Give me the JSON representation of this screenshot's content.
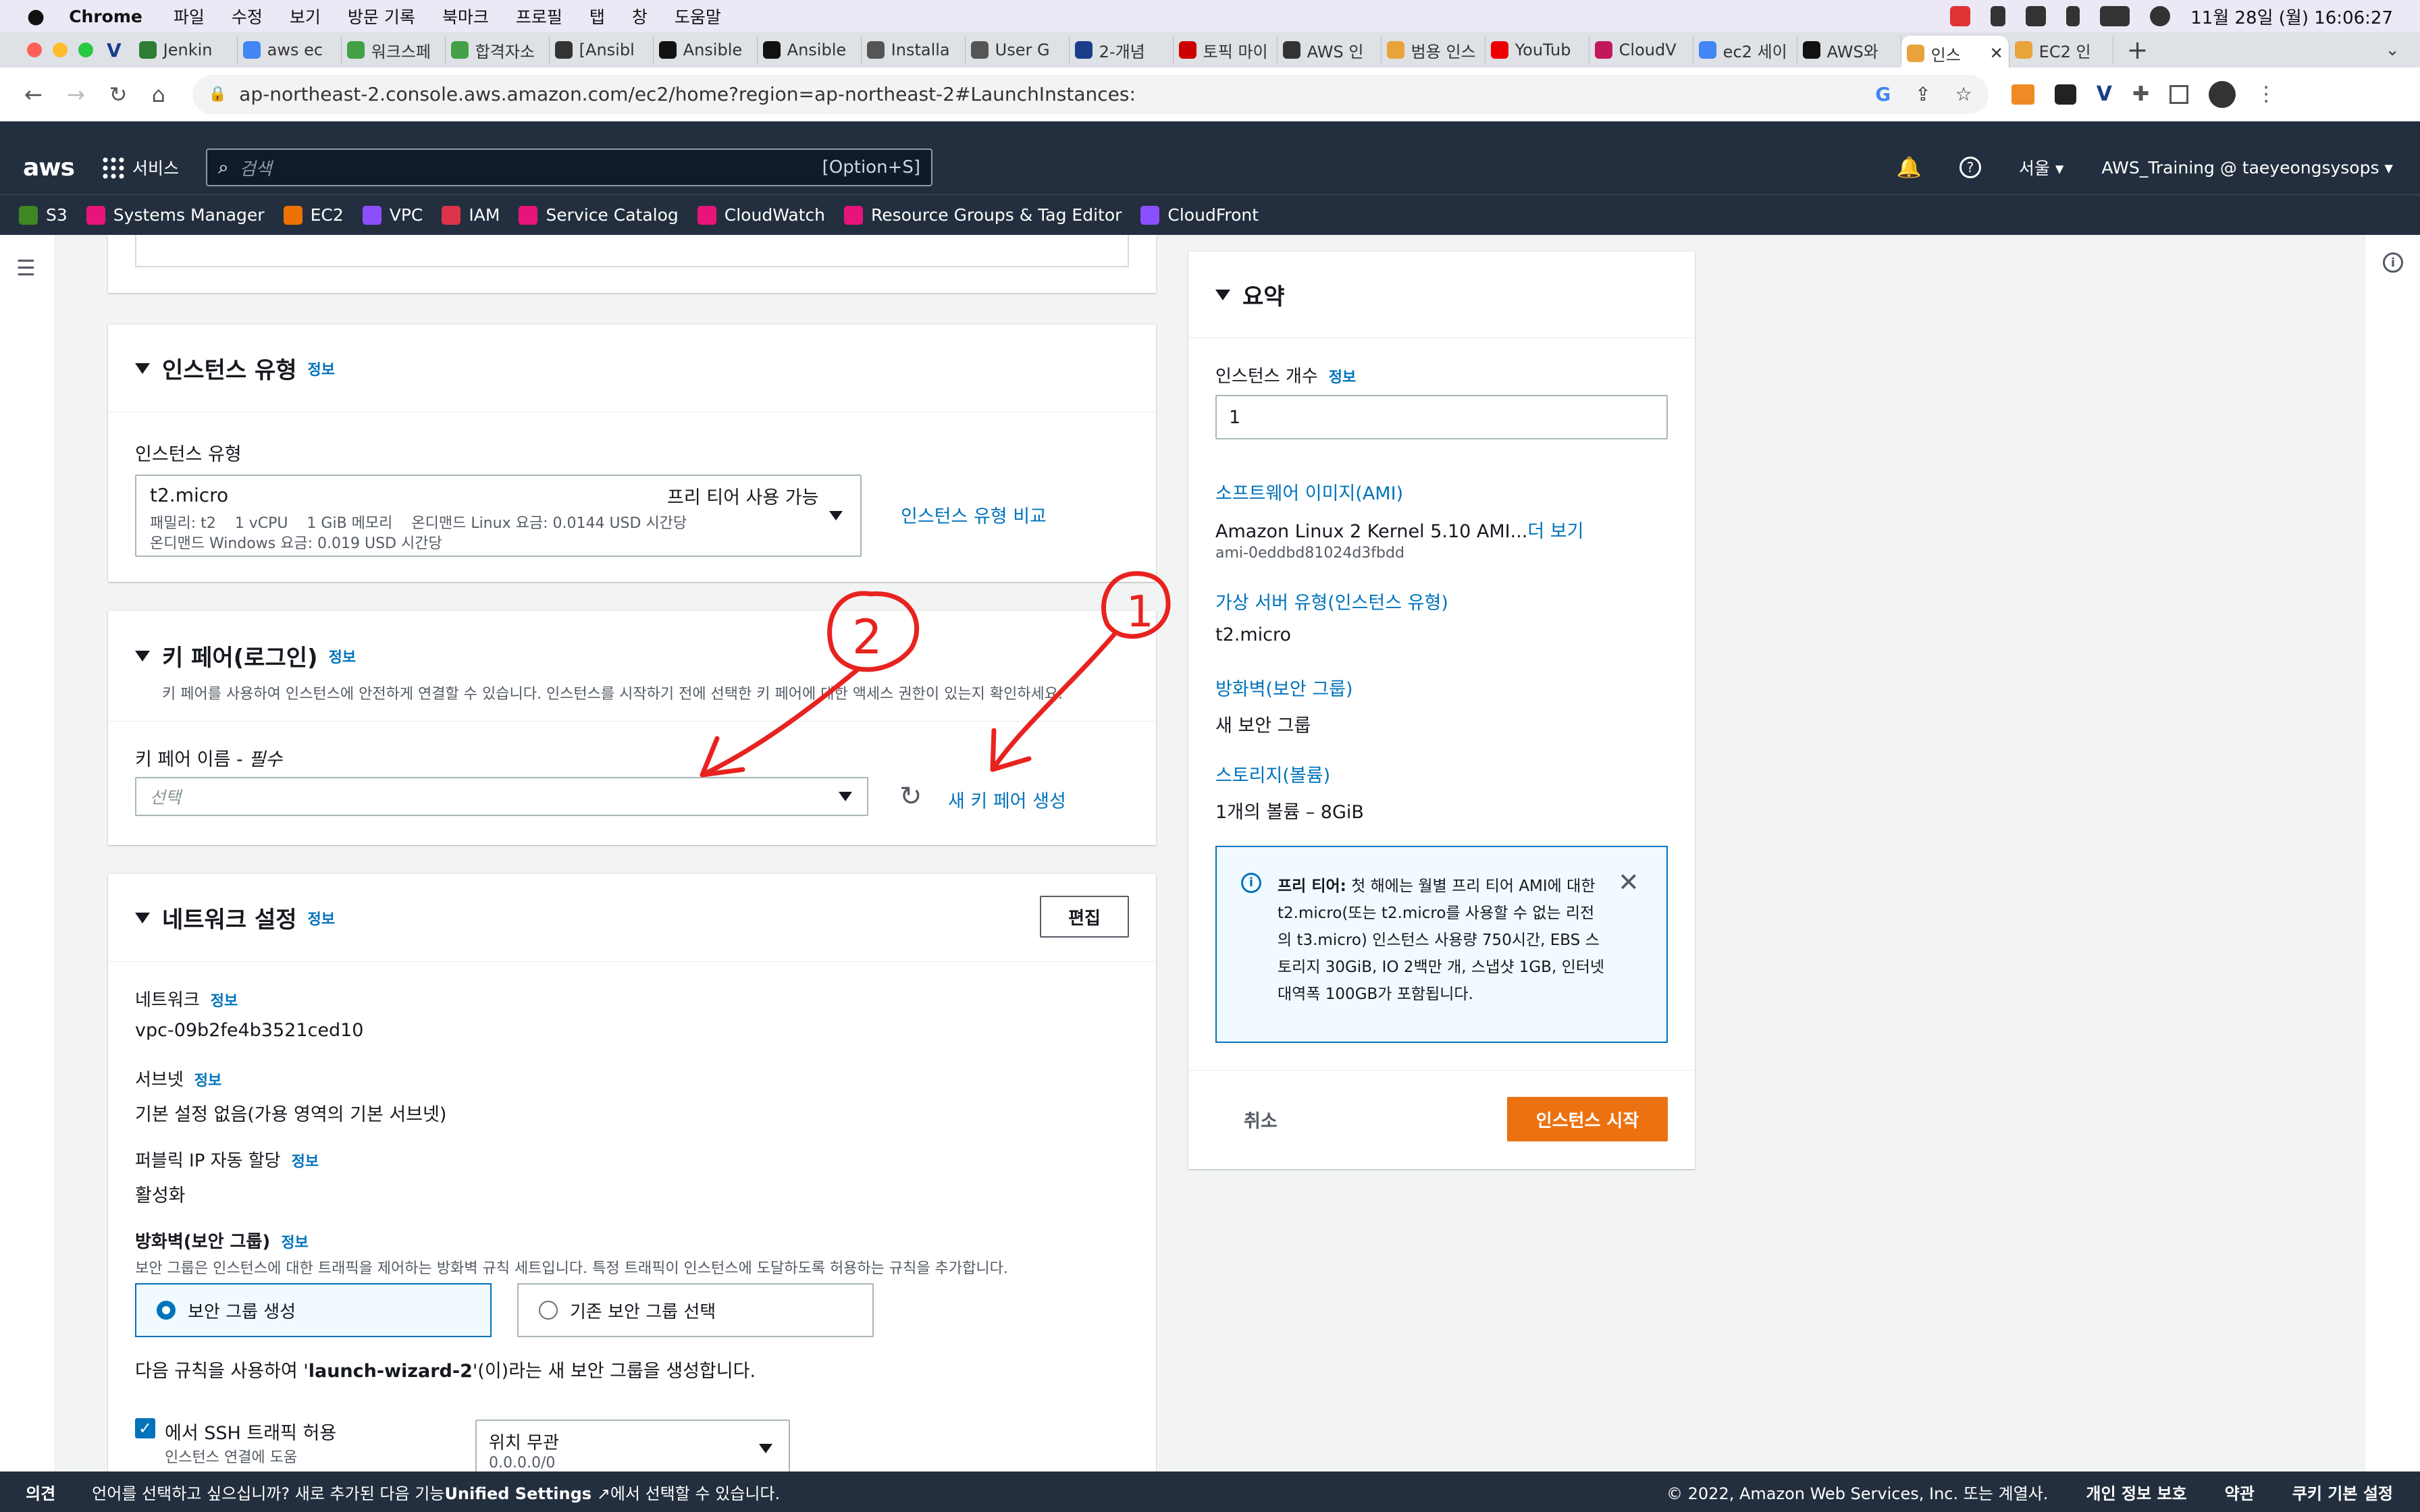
{
  "menubar": {
    "app": "Chrome",
    "items": [
      "파일",
      "수정",
      "보기",
      "방문 기록",
      "북마크",
      "프로필",
      "탭",
      "창",
      "도움말"
    ],
    "datetime": "11월 28일 (월) 16:06:27"
  },
  "tabs": [
    {
      "label": "Jenkin",
      "c": "#2e7d32"
    },
    {
      "label": "aws ec",
      "c": "#4285f4"
    },
    {
      "label": "워크스페",
      "c": "#43a047"
    },
    {
      "label": "합격자소",
      "c": "#43a047"
    },
    {
      "label": "[Ansibl",
      "c": "#333"
    },
    {
      "label": "Ansible",
      "c": "#111"
    },
    {
      "label": "Ansible",
      "c": "#111"
    },
    {
      "label": "Installa",
      "c": "#555"
    },
    {
      "label": "User G",
      "c": "#555"
    },
    {
      "label": "2-개념",
      "c": "#1a3e8a"
    },
    {
      "label": "토픽 마이",
      "c": "#c00"
    },
    {
      "label": "AWS 인",
      "c": "#333"
    },
    {
      "label": "범용 인스",
      "c": "#e8a33a"
    },
    {
      "label": "YouTub",
      "c": "#e00"
    },
    {
      "label": "CloudV",
      "c": "#c2185b"
    },
    {
      "label": "ec2 세이",
      "c": "#4285f4"
    },
    {
      "label": "AWS와",
      "c": "#111"
    },
    {
      "label": "인스",
      "c": "#e8a33a"
    },
    {
      "label": "EC2 인",
      "c": "#e8a33a"
    }
  ],
  "url": "ap-northeast-2.console.aws.amazon.com/ec2/home?region=ap-northeast-2#LaunchInstances:",
  "awsnav": {
    "logo": "aws",
    "services": "서비스",
    "search_placeholder": "검색",
    "search_shortcut": "[Option+S]",
    "region": "서울 ▾",
    "account": "AWS_Training @ taeyeongsysops ▾"
  },
  "favorites": [
    {
      "label": "S3",
      "c": "#3f8624"
    },
    {
      "label": "Systems Manager",
      "c": "#e7157b"
    },
    {
      "label": "EC2",
      "c": "#ed7100"
    },
    {
      "label": "VPC",
      "c": "#8c4fff"
    },
    {
      "label": "IAM",
      "c": "#dd344c"
    },
    {
      "label": "Service Catalog",
      "c": "#e7157b"
    },
    {
      "label": "CloudWatch",
      "c": "#e7157b"
    },
    {
      "label": "Resource Groups & Tag Editor",
      "c": "#e7157b"
    },
    {
      "label": "CloudFront",
      "c": "#8c4fff"
    }
  ],
  "instance_type": {
    "title": "인스턴스 유형",
    "info": "정보",
    "label": "인스턴스 유형",
    "name": "t2.micro",
    "free_tier": "프리 티어 사용 가능",
    "line2": "패밀리: t2    1 vCPU    1 GiB 메모리    온디맨드 Linux 요금: 0.0144 USD 시간당",
    "line3": "온디맨드 Windows 요금: 0.019 USD 시간당",
    "compare_link": "인스턴스 유형 비교"
  },
  "keypair": {
    "title": "키 페어(로그인)",
    "info": "정보",
    "description": "키 페어를 사용하여 인스턴스에 안전하게 연결할 수 있습니다. 인스턴스를 시작하기 전에 선택한 키 페어에 대한 액세스 권한이 있는지 확인하세요.",
    "name_label": "키 페어 이름 - ",
    "required": "필수",
    "placeholder": "선택",
    "create_link": "새 키 페어 생성"
  },
  "annotations": {
    "one": "1",
    "two": "2"
  },
  "network": {
    "title": "네트워크 설정",
    "info": "정보",
    "edit": "편집",
    "network_label": "네트워크",
    "network_value": "vpc-09b2fe4b3521ced10",
    "subnet_label": "서브넷",
    "subnet_value": "기본 설정 없음(가용 영역의 기본 서브넷)",
    "public_ip_label": "퍼블릭 IP 자동 할당",
    "public_ip_value": "활성화",
    "firewall_label": "방화벽(보안 그룹)",
    "firewall_desc": "보안 그룹은 인스턴스에 대한 트래픽을 제어하는 방화벽 규칙 세트입니다. 특정 트래픽이 인스턴스에 도달하도록 허용하는 규칙을 추가합니다.",
    "radio_create": "보안 그룹 생성",
    "radio_existing": "기존 보안 그룹 선택",
    "rule_prefix": "다음 규칙을 사용하여 '",
    "rule_name": "launch-wizard-2",
    "rule_suffix": "'(이)라는 새 보안 그룹을 생성합니다.",
    "ssh_label": "에서 SSH 트래픽 허용",
    "ssh_desc": "인스턴스 연결에 도움",
    "source_value": "위치 무관",
    "source_cidr": "0.0.0.0/0"
  },
  "summary": {
    "title": "요약",
    "count_label": "인스턴스 개수",
    "info": "정보",
    "count_value": "1",
    "ami_label": "소프트웨어 이미지(AMI)",
    "ami_value": "Amazon Linux 2 Kernel 5.10 AMI...",
    "ami_more": "더 보기",
    "ami_id": "ami-0eddbd81024d3fbdd",
    "type_label": "가상 서버 유형(인스턴스 유형)",
    "type_value": "t2.micro",
    "fw_label": "방화벽(보안 그룹)",
    "fw_value": "새 보안 그룹",
    "storage_label": "스토리지(볼륨)",
    "storage_value": "1개의 볼륨 – 8GiB",
    "free_bold": "프리 티어:",
    "free_text": " 첫 해에는 월별 프리 티어 AMI에 대한 t2.micro(또는 t2.micro를 사용할 수 없는 리전의 t3.micro) 인스턴스 사용량 750시간, EBS 스토리지 30GiB, IO 2백만 개, 스냅샷 1GB, 인터넷 대역폭 100GB가 포함됩니다.",
    "cancel": "취소",
    "launch": "인스턴스 시작"
  },
  "footer": {
    "feedback": "의견",
    "lang_prefix": "언어를 선택하고 싶으십니까? 새로 추가된 다음 기능",
    "lang_bold": "Unified Settings",
    "lang_suffix": "에서 선택할 수 있습니다.",
    "copyright": "© 2022, Amazon Web Services, Inc. 또는 계열사.",
    "privacy": "개인 정보 보호",
    "terms": "약관",
    "cookies": "쿠키 기본 설정"
  }
}
